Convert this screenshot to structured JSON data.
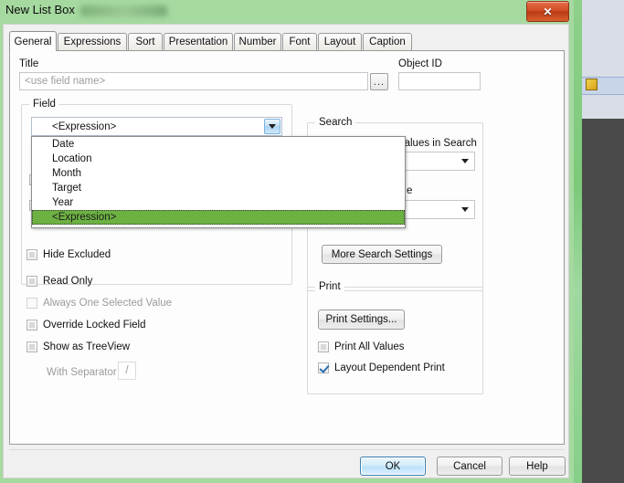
{
  "window": {
    "title": "New List Box",
    "close_label": "✕"
  },
  "tabs": [
    {
      "label": "General",
      "active": true
    },
    {
      "label": "Expressions",
      "active": false
    },
    {
      "label": "Sort",
      "active": false
    },
    {
      "label": "Presentation",
      "active": false
    },
    {
      "label": "Number",
      "active": false
    },
    {
      "label": "Font",
      "active": false
    },
    {
      "label": "Layout",
      "active": false
    },
    {
      "label": "Caption",
      "active": false
    }
  ],
  "general": {
    "title_label": "Title",
    "title_placeholder": "<use field name>",
    "title_value": "",
    "ellipsis_label": "...",
    "object_id_label": "Object ID",
    "object_id_value": "",
    "field_group_label": "Field",
    "field_combo_value": "<Expression>",
    "field_dropdown_items": [
      {
        "label": "Date",
        "selected": false
      },
      {
        "label": "Location",
        "selected": false
      },
      {
        "label": "Month",
        "selected": false
      },
      {
        "label": "Target",
        "selected": false
      },
      {
        "label": "Year",
        "selected": false
      },
      {
        "label": "<Expression>",
        "selected": true
      }
    ],
    "checkboxes": [
      {
        "label": "Hide Excluded",
        "checked": false,
        "enabled": true
      },
      {
        "label": "Read Only",
        "checked": false,
        "enabled": true
      },
      {
        "label": "Always One Selected Value",
        "checked": false,
        "enabled": false
      },
      {
        "label": "Override Locked Field",
        "checked": false,
        "enabled": true
      },
      {
        "label": "Show as TreeView",
        "checked": false,
        "enabled": true
      }
    ],
    "separator_label": "With Separator",
    "separator_value": "/"
  },
  "search": {
    "group_label": "Search",
    "include_excluded_label": "Include Excluded Values in Search",
    "include_excluded_value": "",
    "mode_label_visible_fragment": "e",
    "mode_value": "",
    "more_settings_label": "More Search Settings"
  },
  "print": {
    "group_label": "Print",
    "settings_button_label": "Print Settings...",
    "checkboxes": [
      {
        "label": "Print All Values",
        "checked": false
      },
      {
        "label": "Layout Dependent Print",
        "checked": true
      }
    ]
  },
  "footer": {
    "ok_label": "OK",
    "cancel_label": "Cancel",
    "help_label": "Help"
  },
  "colors": {
    "selection_green": "#6cb142",
    "desktop_green": "#7cc97a",
    "close_red": "#cf4a23",
    "accent_blue": "#3c7fb1",
    "check_blue": "#2b6fb5"
  }
}
